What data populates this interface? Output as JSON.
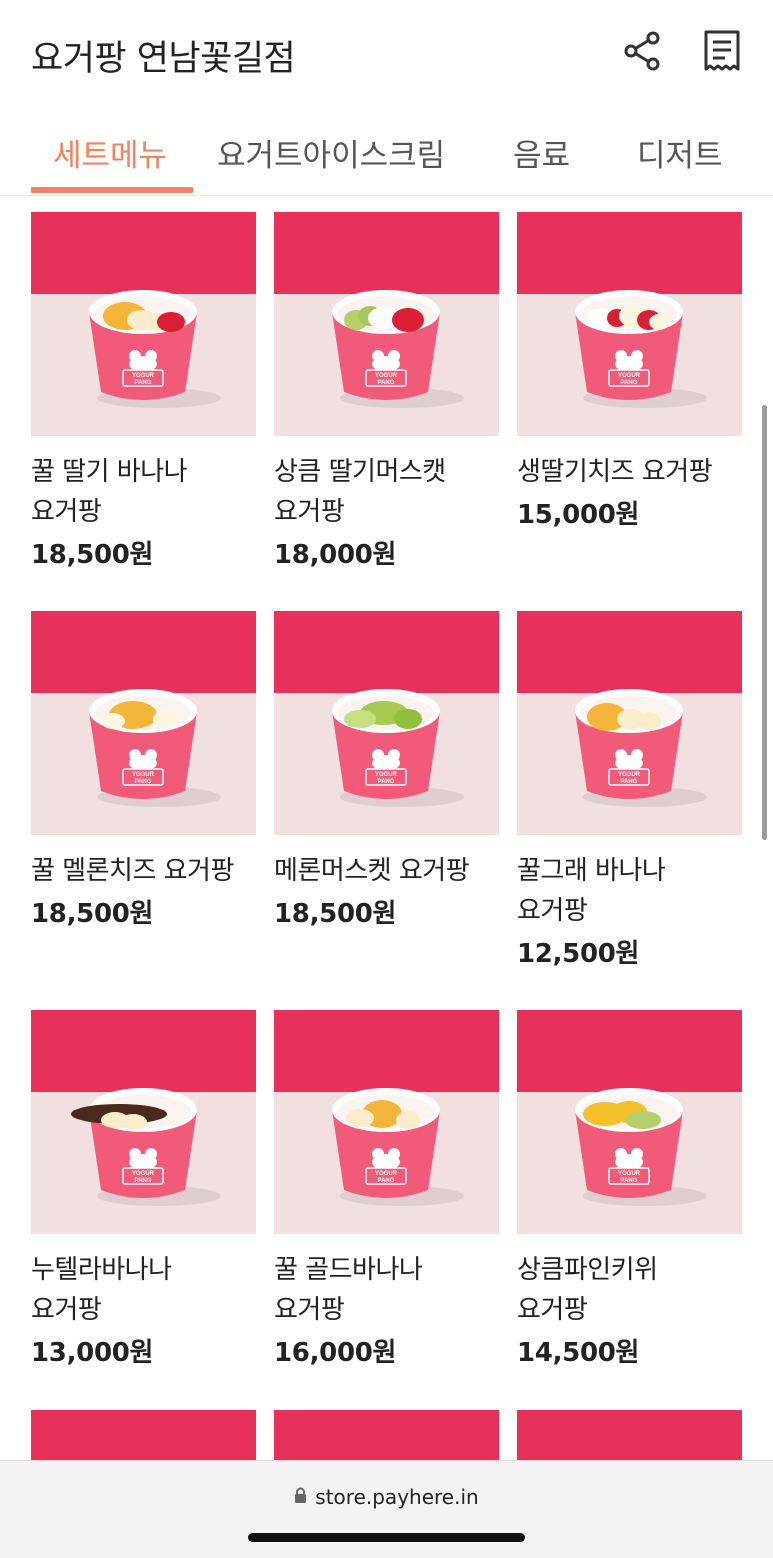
{
  "store": {
    "title": "요거팡 연남꽃길점"
  },
  "header": {
    "share_icon": "share-icon",
    "receipt_icon": "receipt-icon"
  },
  "tabs": [
    {
      "label": "세트메뉴",
      "active": true
    },
    {
      "label": "요거트아이스크림",
      "active": false
    },
    {
      "label": "음료",
      "active": false
    },
    {
      "label": "디저트",
      "active": false
    }
  ],
  "products": [
    {
      "name_line1": "꿀 딸기 바나나",
      "name_line2": "요거팡",
      "price": "18,500원",
      "toppings": "honey-strawberry-banana"
    },
    {
      "name_line1": "상큼 딸기머스캣",
      "name_line2": "요거팡",
      "price": "18,000원",
      "toppings": "grape-strawberry"
    },
    {
      "name_line1": "생딸기치즈 요거팡",
      "name_line2": "",
      "price": "15,000원",
      "toppings": "strawberry-cheese"
    },
    {
      "name_line1": "꿀 멜론치즈 요거팡",
      "name_line2": "",
      "price": "18,500원",
      "toppings": "honey-melon-cheese"
    },
    {
      "name_line1": "메론머스켓 요거팡",
      "name_line2": "",
      "price": "18,500원",
      "toppings": "melon-grape"
    },
    {
      "name_line1": "꿀그래 바나나",
      "name_line2": "요거팡",
      "price": "12,500원",
      "toppings": "honey-banana"
    },
    {
      "name_line1": "누텔라바나나",
      "name_line2": "요거팡",
      "price": "13,000원",
      "toppings": "nutella-banana"
    },
    {
      "name_line1": "꿀 골드바나나",
      "name_line2": "요거팡",
      "price": "16,000원",
      "toppings": "honey-gold-banana"
    },
    {
      "name_line1": "상큼파인키위",
      "name_line2": "요거팡",
      "price": "14,500원",
      "toppings": "pineapple-kiwi"
    }
  ],
  "cup_label": {
    "line1": "YOGUR",
    "line2": "PANG"
  },
  "browser": {
    "url": "store.payhere.in",
    "lock_icon": "lock-icon"
  },
  "colors": {
    "accent": "#f0845c",
    "backdrop": "#e8315a",
    "table": "#f2dede",
    "cup": "#f25a7a"
  }
}
